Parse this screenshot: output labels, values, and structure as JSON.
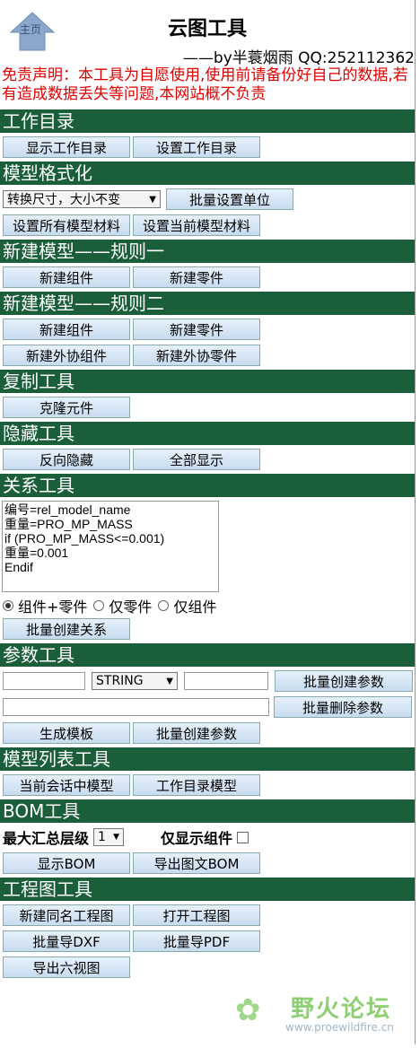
{
  "header": {
    "home_label": "主页",
    "title": "云图工具",
    "byline": "——by半蓑烟雨 QQ:252112362"
  },
  "disclaimer": "免责声明：本工具为自愿使用,使用前请备份好自己的数据,若有造成数据丢失等问题,本网站概不负责",
  "sections": {
    "workdir": {
      "title": "工作目录",
      "show": "显示工作目录",
      "set": "设置工作目录"
    },
    "format": {
      "title": "模型格式化",
      "select_value": "转换尺寸，大小不变",
      "batch_unit": "批量设置单位",
      "set_all_material": "设置所有模型材料",
      "set_current_material": "设置当前模型材料"
    },
    "rule1": {
      "title": "新建模型——规则一",
      "new_asm": "新建组件",
      "new_part": "新建零件"
    },
    "rule2": {
      "title": "新建模型——规则二",
      "new_asm": "新建组件",
      "new_part": "新建零件",
      "new_ext_asm": "新建外协组件",
      "new_ext_part": "新建外协零件"
    },
    "copy": {
      "title": "复制工具",
      "clone": "克隆元件"
    },
    "hide": {
      "title": "隐藏工具",
      "reverse_hide": "反向隐藏",
      "show_all": "全部显示"
    },
    "relation": {
      "title": "关系工具",
      "text": "编号=rel_model_name\n重量=PRO_MP_MASS\nif (PRO_MP_MASS<=0.001)\n重量=0.001\nEndif",
      "radio_asm_part": "组件+零件",
      "radio_part": "仅零件",
      "radio_asm": "仅组件",
      "create": "批量创建关系"
    },
    "param": {
      "title": "参数工具",
      "type_value": "STRING",
      "batch_create": "批量创建参数",
      "batch_delete": "批量删除参数",
      "gen_template": "生成模板",
      "batch_create2": "批量创建参数"
    },
    "modellist": {
      "title": "模型列表工具",
      "session": "当前会话中模型",
      "workdir": "工作目录模型"
    },
    "bom": {
      "title": "BOM工具",
      "level_label": "最大汇总层级",
      "level_value": "1",
      "asm_only": "仅显示组件",
      "show": "显示BOM",
      "export": "导出图文BOM"
    },
    "drawing": {
      "title": "工程图工具",
      "new_same": "新建同名工程图",
      "open": "打开工程图",
      "dxf": "批量导DXF",
      "pdf": "批量导PDF",
      "six_views": "导出六视图"
    }
  },
  "watermark": {
    "text": "野火论坛",
    "url": "www.proewildfire.cn"
  },
  "colors": {
    "section_bg": "#1b5e3a",
    "disclaimer": "#e00000",
    "button_top": "#e6f0fa",
    "button_bottom": "#c8dcf0"
  }
}
